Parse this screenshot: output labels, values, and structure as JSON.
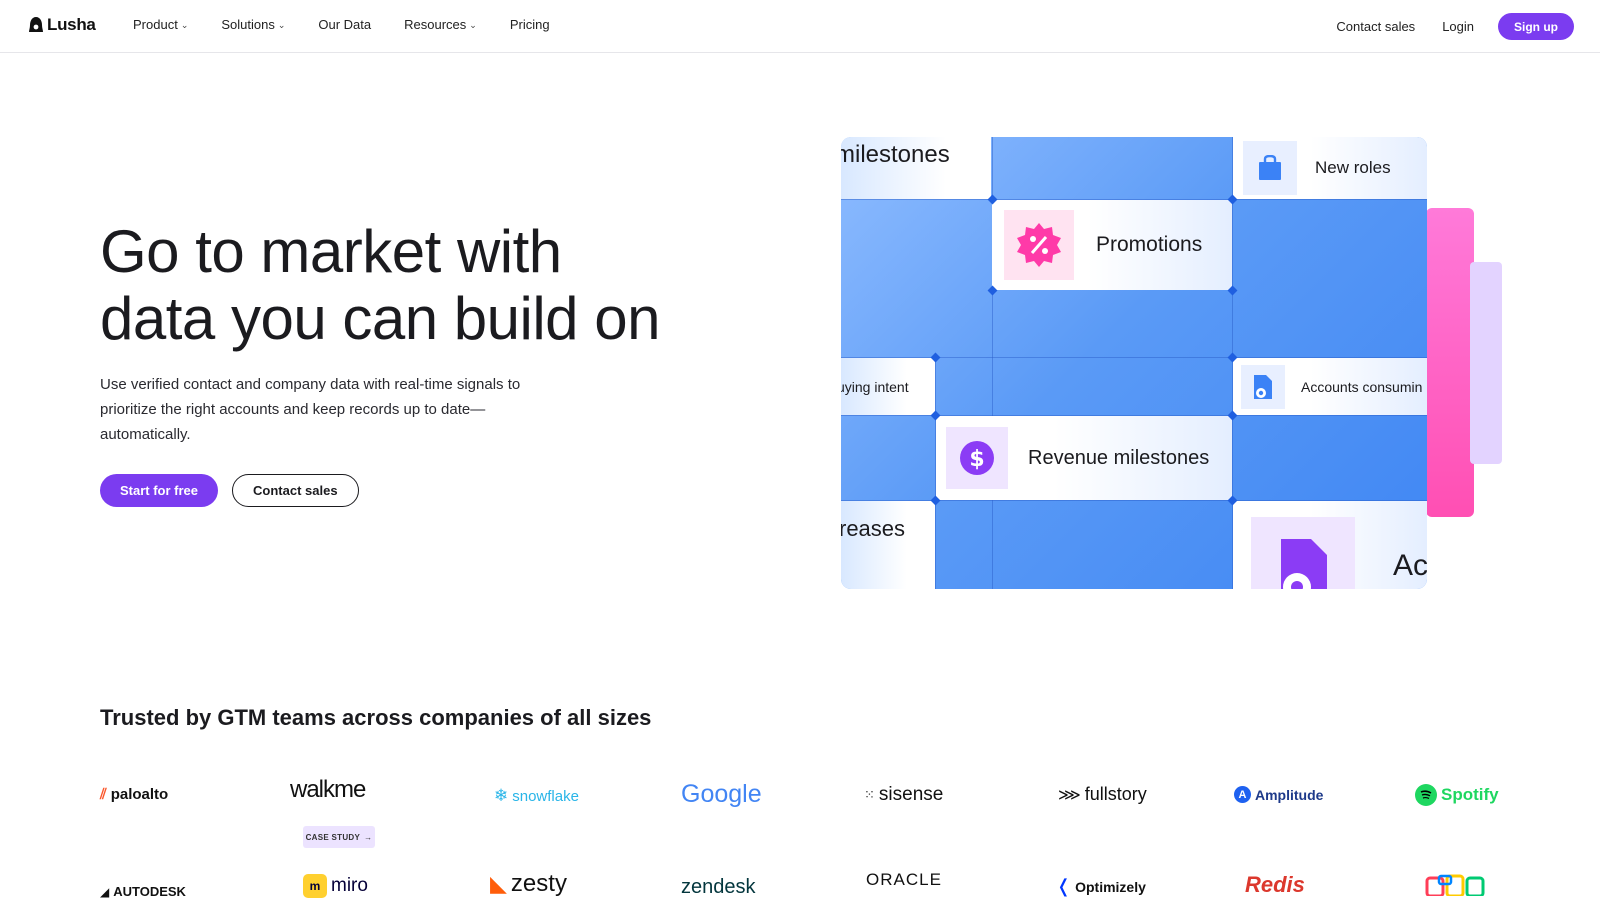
{
  "nav": {
    "logo_text": "Lusha",
    "links": [
      {
        "label": "Product",
        "has_caret": true
      },
      {
        "label": "Solutions",
        "has_caret": true
      },
      {
        "label": "Our Data",
        "has_caret": false
      },
      {
        "label": "Resources",
        "has_caret": true
      },
      {
        "label": "Pricing",
        "has_caret": false
      }
    ],
    "contact_sales": "Contact sales",
    "login": "Login",
    "signup": "Sign up"
  },
  "hero": {
    "title_line1": "Go to market with",
    "title_line2": "data you can build on",
    "subtitle": "Use verified contact and company data with real-time signals to prioritize the right accounts and keep records up to date—automatically.",
    "primary_cta": "Start for free",
    "secondary_cta": "Contact sales"
  },
  "illustration": {
    "cards": {
      "milestones": "milestones",
      "new_roles": "New roles",
      "promotions": "Promotions",
      "buying_intent": "uying intent",
      "accounts_consuming": "Accounts consumin",
      "revenue_milestones": "Revenue milestones",
      "increases": "reases",
      "ac": "Ac"
    },
    "icons": {
      "new_roles": "briefcase-icon",
      "promotions": "percent-badge-icon",
      "accounts_consuming": "document-eye-icon",
      "revenue_milestones": "dollar-icon",
      "ac": "document-eye-icon"
    }
  },
  "trusted": {
    "heading": "Trusted by GTM teams across companies of all sizes",
    "case_study": "CASE STUDY",
    "row1": [
      "paloalto",
      "walkme",
      "snowflake",
      "Google",
      "sisense",
      "fullstory",
      "Amplitude",
      "Spotify"
    ],
    "row2": [
      "AUTODESK",
      "miro",
      "zesty",
      "zendesk",
      "ORACLE",
      "Optimizely",
      "Redis",
      "Monday"
    ]
  },
  "colors": {
    "brand_purple": "#7b3cf0",
    "grid_blue": "#4a8ef5",
    "accent_pink": "#ff4fb3"
  }
}
